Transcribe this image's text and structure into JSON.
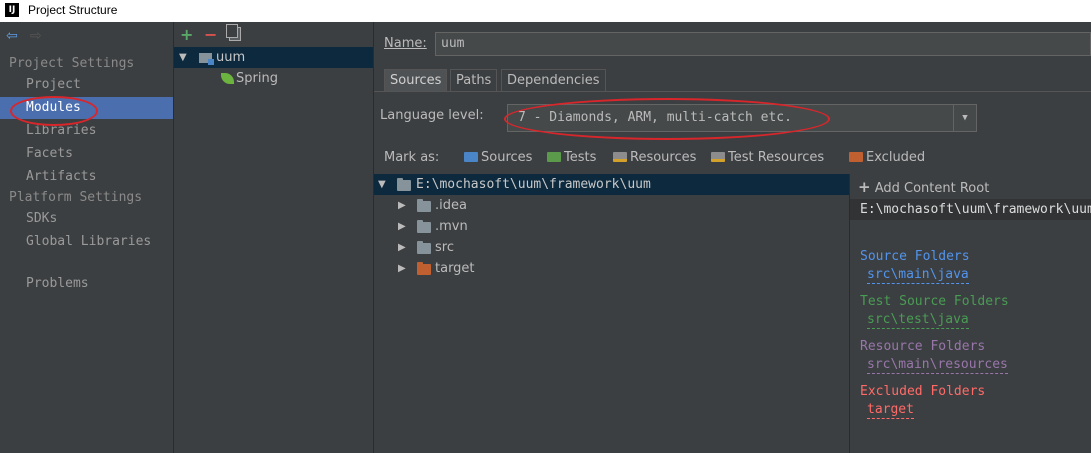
{
  "window": {
    "title": "Project Structure",
    "app_icon": "IJ"
  },
  "sidebar": {
    "sections": [
      {
        "header": "Project Settings",
        "items": [
          "Project",
          "Modules",
          "Libraries",
          "Facets",
          "Artifacts"
        ]
      },
      {
        "header": "Platform Settings",
        "items": [
          "SDKs",
          "Global Libraries"
        ]
      }
    ],
    "problems": "Problems",
    "selected": "Modules"
  },
  "module_tree": {
    "toolbar": {
      "add": "+",
      "remove": "−",
      "copy_icon": "copy-icon"
    },
    "root": "uum",
    "children": [
      "Spring"
    ]
  },
  "module": {
    "name_label": "Name:",
    "name_value": "uum",
    "tabs": [
      "Sources",
      "Paths",
      "Dependencies"
    ],
    "active_tab": "Sources",
    "language_level_label": "Language level:",
    "language_level_value": "7 - Diamonds, ARM, multi-catch etc.",
    "mark_as_label": "Mark as:",
    "mark_as": [
      {
        "label": "Sources",
        "color": "#4a86c7"
      },
      {
        "label": "Tests",
        "color": "#5a9a4a"
      },
      {
        "label": "Resources",
        "color": "#8c8c8c"
      },
      {
        "label": "Test Resources",
        "color": "#8c8c8c"
      },
      {
        "label": "Excluded",
        "color": "#c06030"
      }
    ]
  },
  "file_tree": {
    "root": "E:\\mochasoft\\uum\\framework\\uum",
    "children": [
      {
        "name": ".idea",
        "color": "#87939a"
      },
      {
        "name": ".mvn",
        "color": "#87939a"
      },
      {
        "name": "src",
        "color": "#87939a"
      },
      {
        "name": "target",
        "color": "#c06030"
      }
    ]
  },
  "content_root": {
    "add_label": "Add Content Root",
    "path": "E:\\mochasoft\\uum\\framework\\uum",
    "groups": [
      {
        "label": "Source Folders",
        "path": "src\\main\\java",
        "color": "#5394ec"
      },
      {
        "label": "Test Source Folders",
        "path": "src\\test\\java",
        "color": "#499c54"
      },
      {
        "label": "Resource Folders",
        "path": "src\\main\\resources",
        "color": "#9876aa"
      },
      {
        "label": "Excluded Folders",
        "path": "target",
        "color": "#ff6b68"
      }
    ]
  }
}
